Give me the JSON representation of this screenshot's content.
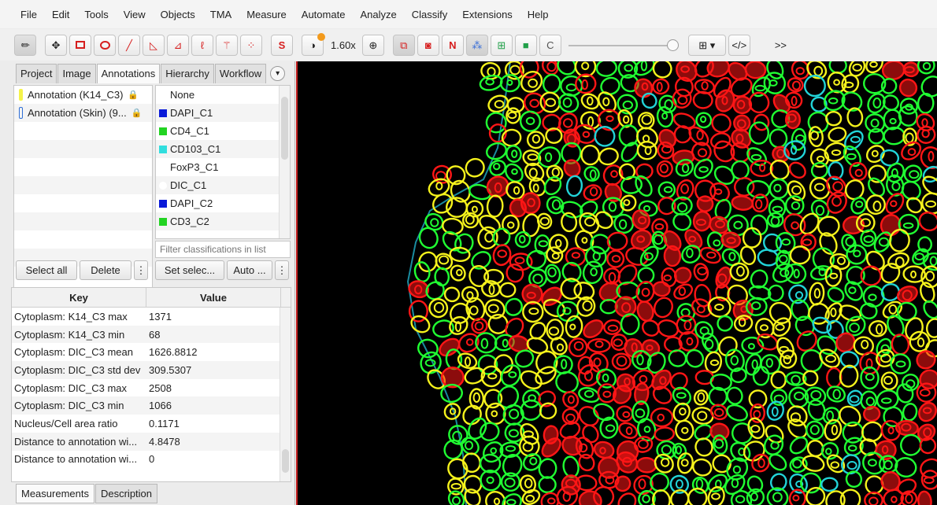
{
  "menu": [
    "File",
    "Edit",
    "Tools",
    "View",
    "Objects",
    "TMA",
    "Measure",
    "Automate",
    "Analyze",
    "Classify",
    "Extensions",
    "Help"
  ],
  "toolbar": {
    "zoom": "1.60x",
    "s_label": "S",
    "n_label": "N",
    "c_label": "C",
    "more_label": ">>"
  },
  "tabs": [
    "Project",
    "Image",
    "Annotations",
    "Hierarchy",
    "Workflow"
  ],
  "active_tab": "Annotations",
  "annotations": [
    {
      "label": "Annotation (K14_C3)",
      "color": "#f5f34a"
    },
    {
      "label": "Annotation (Skin) (9...",
      "color": "#2f6fd6"
    }
  ],
  "classifications": [
    {
      "label": "None",
      "color": ""
    },
    {
      "label": "DAPI_C1",
      "color": "#0a1ad8"
    },
    {
      "label": "CD4_C1",
      "color": "#22d322"
    },
    {
      "label": "CD103_C1",
      "color": "#31dede"
    },
    {
      "label": "FoxP3_C1",
      "color": ""
    },
    {
      "label": "DIC_C1",
      "color": "#ffffff"
    },
    {
      "label": "DAPI_C2",
      "color": "#0a1ad8"
    },
    {
      "label": "CD3_C2",
      "color": "#22d322"
    }
  ],
  "filter_placeholder": "Filter classifications in list",
  "buttons": {
    "select_all": "Select all",
    "delete": "Delete",
    "more": "⋮",
    "set_selected": "Set selec...",
    "auto": "Auto ..."
  },
  "table": {
    "headers": [
      "Key",
      "Value"
    ],
    "rows": [
      [
        "Cytoplasm: K14_C3 max",
        "1371"
      ],
      [
        "Cytoplasm: K14_C3 min",
        "68"
      ],
      [
        "Cytoplasm: DIC_C3 mean",
        "1626.8812"
      ],
      [
        "Cytoplasm: DIC_C3 std dev",
        "309.5307"
      ],
      [
        "Cytoplasm: DIC_C3 max",
        "2508"
      ],
      [
        "Cytoplasm: DIC_C3 min",
        "1066"
      ],
      [
        "Nucleus/Cell area ratio",
        "0.1171"
      ],
      [
        "Distance to annotation wi...",
        "4.8478"
      ],
      [
        "Distance to annotation wi...",
        "0"
      ]
    ]
  },
  "bottom_tabs": [
    "Measurements",
    "Description"
  ],
  "colors": {
    "yellow": "#f5f21c",
    "green": "#20ff32",
    "red": "#ff1616",
    "cyan": "#22d4d8",
    "outline": "#1a8ca0"
  }
}
